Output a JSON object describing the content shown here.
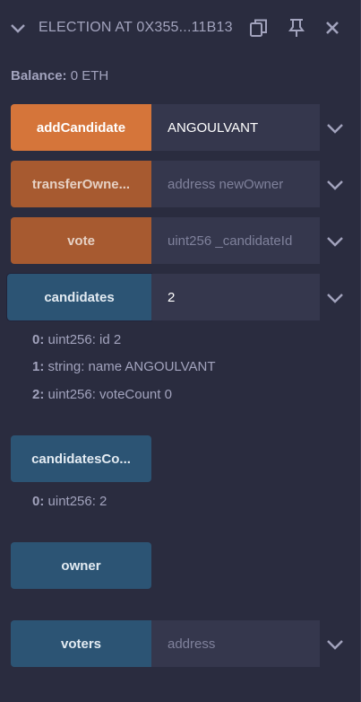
{
  "header": {
    "title": "ELECTION AT 0X355...11B13",
    "copy_icon": "copy-icon",
    "pin_icon": "pin-icon",
    "close_icon": "close-icon"
  },
  "balance": {
    "label": "Balance:",
    "value": "0 ETH"
  },
  "functions": [
    {
      "label": "addCandidate",
      "input_value": "ANGOULVANT",
      "input_placeholder": ""
    },
    {
      "label": "transferOwne...",
      "input_value": "",
      "input_placeholder": "address newOwner"
    },
    {
      "label": "vote",
      "input_value": "",
      "input_placeholder": "uint256 _candidateId"
    },
    {
      "label": "candidates",
      "input_value": "2",
      "input_placeholder": ""
    },
    {
      "label": "candidatesCo..."
    },
    {
      "label": "owner"
    },
    {
      "label": "voters",
      "input_value": "",
      "input_placeholder": "address"
    }
  ],
  "candidates_output": [
    {
      "index": "0:",
      "text": "uint256: id 2"
    },
    {
      "index": "1:",
      "text": "string: name ANGOULVANT"
    },
    {
      "index": "2:",
      "text": "uint256: voteCount 0"
    }
  ],
  "candidates_count_output": [
    {
      "index": "0:",
      "text": "uint256: 2"
    }
  ],
  "colors": {
    "background": "#2a2c3f",
    "transact_orange": "#d5753a",
    "payable_orange": "#a75a30",
    "call_blue": "#2c5474",
    "input_bg": "#35374d"
  }
}
